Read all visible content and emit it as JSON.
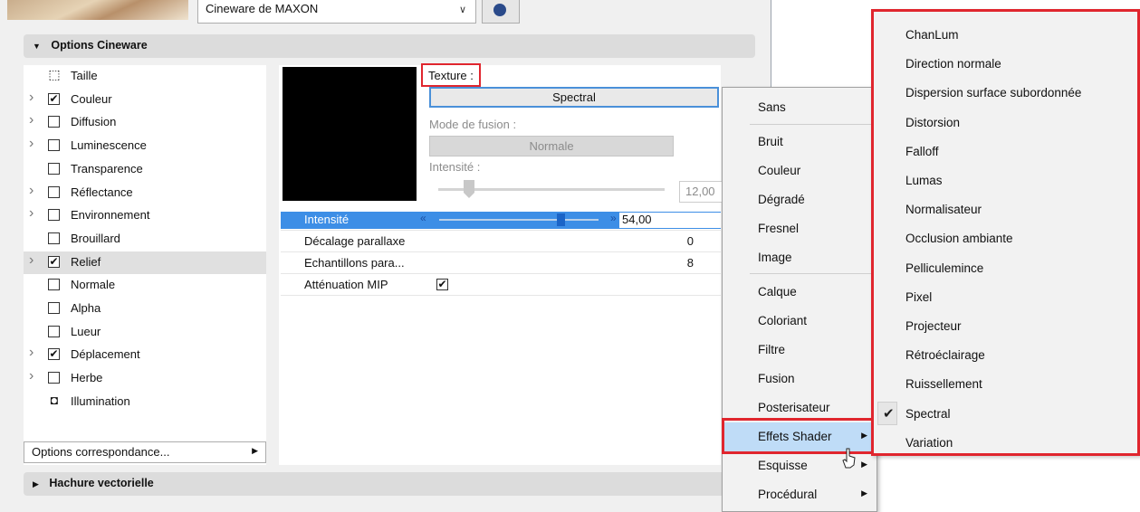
{
  "renderer": {
    "selected": "Cineware de MAXON"
  },
  "sections": {
    "options_title": "Options Cineware",
    "hachure_title": "Hachure vectorielle"
  },
  "channels": [
    {
      "label": "Taille",
      "expandable": false,
      "checked": null,
      "icon": "resize-icon"
    },
    {
      "label": "Couleur",
      "expandable": true,
      "checked": true
    },
    {
      "label": "Diffusion",
      "expandable": true,
      "checked": false
    },
    {
      "label": "Luminescence",
      "expandable": true,
      "checked": false
    },
    {
      "label": "Transparence",
      "expandable": false,
      "checked": false
    },
    {
      "label": "Réflectance",
      "expandable": true,
      "checked": false
    },
    {
      "label": "Environnement",
      "expandable": true,
      "checked": false
    },
    {
      "label": "Brouillard",
      "expandable": false,
      "checked": false
    },
    {
      "label": "Relief",
      "expandable": true,
      "checked": true,
      "selected": true
    },
    {
      "label": "Normale",
      "expandable": false,
      "checked": false
    },
    {
      "label": "Alpha",
      "expandable": false,
      "checked": false
    },
    {
      "label": "Lueur",
      "expandable": false,
      "checked": false
    },
    {
      "label": "Déplacement",
      "expandable": true,
      "checked": true
    },
    {
      "label": "Herbe",
      "expandable": true,
      "checked": false
    },
    {
      "label": "Illumination",
      "expandable": false,
      "checked": null,
      "icon": "lightbulb-icon"
    }
  ],
  "options_correspondance": "Options correspondance...",
  "texture": {
    "label": "Texture :",
    "value": "Spectral",
    "mode_label": "Mode de fusion :",
    "mode_value": "Normale",
    "intensity_label": "Intensité :",
    "intensity_value": "12,00"
  },
  "properties": {
    "intensite_label": "Intensité",
    "intensite_value": "54,00",
    "intensite_level": 0.54,
    "decalage_label": "Décalage parallaxe",
    "decalage_value": "0",
    "echant_label": "Echantillons para...",
    "echant_value": "8",
    "attenuation_label": "Atténuation MIP",
    "attenuation_checked": true
  },
  "menu1": {
    "items": [
      {
        "label": "Sans"
      },
      {
        "label": "Bruit"
      },
      {
        "label": "Couleur"
      },
      {
        "label": "Dégradé"
      },
      {
        "label": "Fresnel"
      },
      {
        "label": "Image"
      },
      {
        "label": "Calque"
      },
      {
        "label": "Coloriant"
      },
      {
        "label": "Filtre"
      },
      {
        "label": "Fusion"
      },
      {
        "label": "Posterisateur"
      },
      {
        "label": "Effets Shader",
        "submenu": true,
        "highlighted": true
      },
      {
        "label": "Esquisse",
        "submenu": true
      },
      {
        "label": "Procédural",
        "submenu": true
      }
    ]
  },
  "menu2": {
    "items": [
      {
        "label": "ChanLum"
      },
      {
        "label": "Direction normale"
      },
      {
        "label": "Dispersion surface subordonnée"
      },
      {
        "label": "Distorsion"
      },
      {
        "label": "Falloff"
      },
      {
        "label": "Lumas"
      },
      {
        "label": "Normalisateur"
      },
      {
        "label": "Occlusion ambiante"
      },
      {
        "label": "Pelliculemince"
      },
      {
        "label": "Pixel"
      },
      {
        "label": "Projecteur"
      },
      {
        "label": "Rétroéclairage"
      },
      {
        "label": "Ruissellement"
      },
      {
        "label": "Spectral",
        "checked": true
      },
      {
        "label": "Variation"
      }
    ]
  },
  "colors": {
    "highlight_red": "#e0262e",
    "selection_blue": "#3d8ee6",
    "menu_hover": "#bfdcf7"
  }
}
